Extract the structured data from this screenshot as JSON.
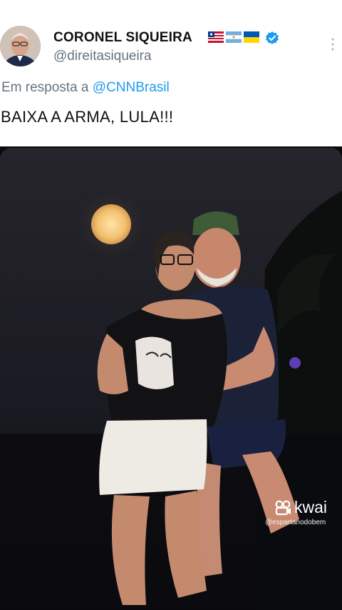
{
  "tweet": {
    "display_name": "CORONEL SIQUEIRA",
    "handle": "@direitasiqueira",
    "reply_prefix": "Em resposta a",
    "reply_mention": "@CNNBrasil",
    "text": "BAIXA A ARMA, LULA!!!",
    "flags": [
      "maranhao-flag-icon",
      "argentina-flag-icon",
      "ukraine-flag-icon"
    ],
    "verified_color": "#1d9bf0",
    "mention_color": "#1d9bf0"
  },
  "watermark": {
    "brand": "kwai",
    "user": "@espartanodobem"
  },
  "photo": {
    "description_icon": "night-photo"
  }
}
